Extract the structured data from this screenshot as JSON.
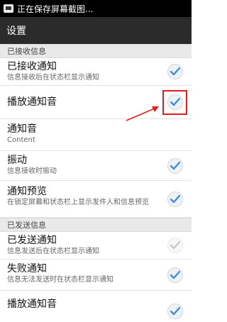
{
  "statusbar": {
    "text": "正在保存屏幕截图..."
  },
  "titlebar": {
    "title": "设置"
  },
  "sections": [
    {
      "label": "已接收信息",
      "items": [
        {
          "title": "已接收通知",
          "subtitle": "信息接收后在状态栏显示通知",
          "checked": true
        },
        {
          "title": "播放通知音",
          "subtitle": "",
          "checked": true,
          "highlighted": true
        },
        {
          "title": "通知音",
          "subtitle": "Content",
          "checked": null
        },
        {
          "title": "振动",
          "subtitle": "信息接收时振动",
          "checked": true
        },
        {
          "title": "通知预览",
          "subtitle": "在锁定屏幕和状态栏上显示发件人和信息预览",
          "checked": true
        }
      ]
    },
    {
      "label": "已发送信息",
      "items": [
        {
          "title": "已发送通知",
          "subtitle": "信息发送后在状态栏显示通知",
          "checked": true,
          "dimmed": true
        },
        {
          "title": "失败通知",
          "subtitle": "信息无法发送时在状态栏显示通知",
          "checked": true
        },
        {
          "title": "播放通知音",
          "subtitle": "",
          "checked": true
        }
      ]
    }
  ],
  "colors": {
    "annotation_red": "#e21b1b",
    "check_blue": "#3a8fd8"
  }
}
